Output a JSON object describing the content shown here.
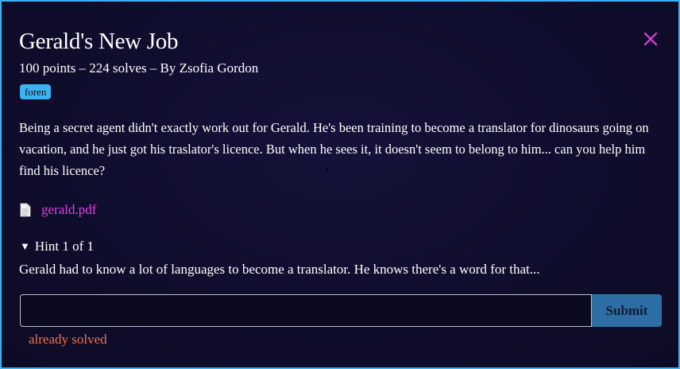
{
  "challenge": {
    "title": "Gerald's New Job",
    "meta": "100 points – 224 solves – By Zsofia Gordon",
    "tag": "foren",
    "description": "Being a secret agent didn't exactly work out for Gerald. He's been training to become a translator for dinosaurs going on vacation, and he just got his traslator's licence. But when he sees it, it doesn't seem to belong to him... can you help him find his licence?",
    "attachment": {
      "name": "gerald.pdf",
      "icon": "file-icon"
    },
    "hint": {
      "label": "Hint 1 of 1",
      "text": "Gerald had to know a lot of languages to become a translator. He knows there's a word for that..."
    }
  },
  "form": {
    "input_value": "",
    "submit_label": "Submit",
    "status": "already solved"
  },
  "colors": {
    "border": "#3db2f0",
    "tag": "#3db2f0",
    "link": "#e040e0",
    "close": "#e040e0",
    "submit": "#2d6fa5",
    "status": "#f0714f"
  },
  "icons": {
    "close": "close-icon",
    "file": "file-icon",
    "hint_toggle": "triangle-down-icon"
  }
}
